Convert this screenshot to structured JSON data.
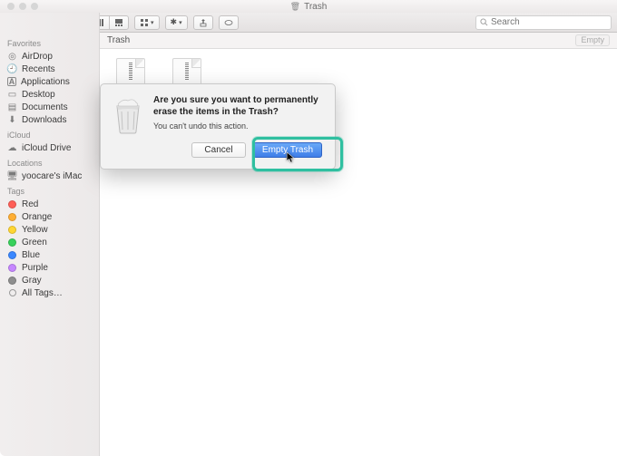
{
  "window": {
    "title": "Trash"
  },
  "toolbar": {
    "search_placeholder": "Search",
    "view_segments": [
      "icon",
      "list",
      "column",
      "gallery"
    ],
    "arrange_label": "",
    "path_location": "Trash",
    "empty_label": "Empty"
  },
  "sidebar": {
    "sections": [
      {
        "title": "Favorites",
        "items": [
          {
            "icon": "airdrop-icon",
            "label": "AirDrop"
          },
          {
            "icon": "recents-icon",
            "label": "Recents"
          },
          {
            "icon": "applications-icon",
            "label": "Applications"
          },
          {
            "icon": "desktop-icon",
            "label": "Desktop"
          },
          {
            "icon": "documents-icon",
            "label": "Documents"
          },
          {
            "icon": "downloads-icon",
            "label": "Downloads"
          }
        ]
      },
      {
        "title": "iCloud",
        "items": [
          {
            "icon": "icloud-icon",
            "label": "iCloud Drive"
          }
        ]
      },
      {
        "title": "Locations",
        "items": [
          {
            "icon": "imac-icon",
            "label": "yoocare's iMac"
          }
        ]
      },
      {
        "title": "Tags",
        "items": [
          {
            "color": "#ff5f57",
            "label": "Red"
          },
          {
            "color": "#ffae33",
            "label": "Orange"
          },
          {
            "color": "#ffd633",
            "label": "Yellow"
          },
          {
            "color": "#38d15b",
            "label": "Green"
          },
          {
            "color": "#3a87ff",
            "label": "Blue"
          },
          {
            "color": "#c687ff",
            "label": "Purple"
          },
          {
            "color": "#8e8e8e",
            "label": "Gray"
          },
          {
            "hollow": true,
            "label": "All Tags…"
          }
        ]
      }
    ]
  },
  "files": [
    {
      "type": "ZIP"
    },
    {
      "type": "ZIP"
    }
  ],
  "dialog": {
    "heading": "Are you sure you want to permanently erase the items in the Trash?",
    "body": "You can't undo this action.",
    "cancel": "Cancel",
    "confirm": "Empty Trash"
  }
}
